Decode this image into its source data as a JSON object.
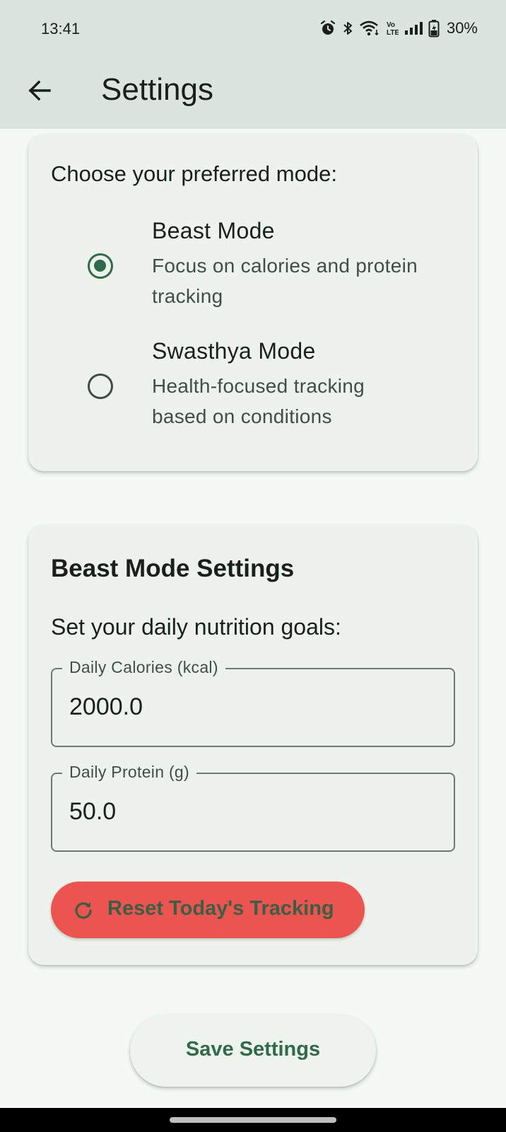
{
  "status_bar": {
    "time": "13:41",
    "battery_percent": "30%",
    "icons": [
      "alarm-icon",
      "bluetooth-icon",
      "wifi-icon",
      "volte-icon",
      "signal-icon",
      "battery-charging-icon"
    ]
  },
  "app_bar": {
    "title": "Settings",
    "back_icon": "arrow-left-icon"
  },
  "mode_card": {
    "prompt": "Choose your preferred mode:",
    "options": [
      {
        "title": "Beast Mode",
        "description": "Focus on calories and protein tracking",
        "selected": true
      },
      {
        "title": "Swasthya Mode",
        "description": "Health-focused tracking based on conditions",
        "selected": false
      }
    ]
  },
  "beast_settings": {
    "title": "Beast Mode Settings",
    "subtitle": "Set your daily nutrition goals:",
    "fields": [
      {
        "label": "Daily Calories (kcal)",
        "value": "2000.0"
      },
      {
        "label": "Daily Protein (g)",
        "value": "50.0"
      }
    ],
    "reset_button_label": "Reset Today's Tracking",
    "reset_icon": "refresh-icon"
  },
  "save_button_label": "Save Settings",
  "colors": {
    "app_bar_bg": "#dbe5dd",
    "page_bg": "#f4f9f4",
    "card_bg": "#edf3ec",
    "primary": "#2f6a4a",
    "reset_bg": "#ec5450",
    "reset_text": "#3b5f45"
  }
}
